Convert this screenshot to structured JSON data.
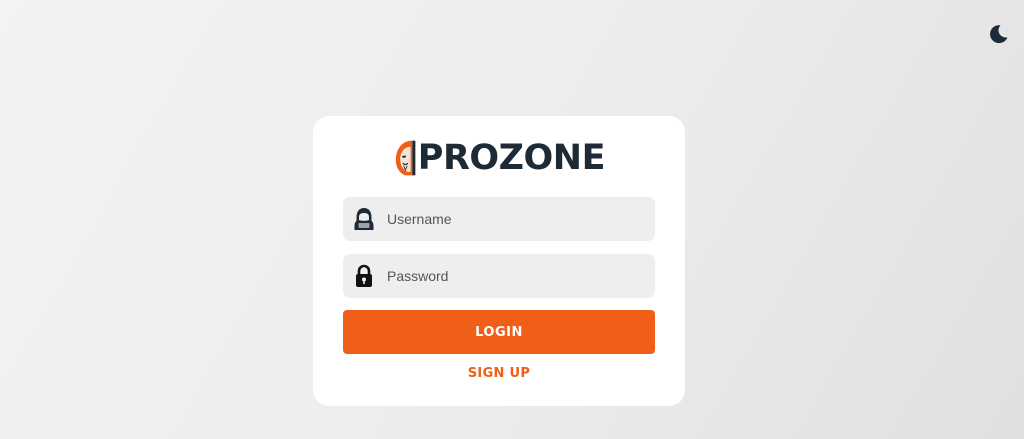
{
  "header": {
    "theme_toggle_icon": "moon-icon"
  },
  "login_card": {
    "logo_text": "PROZONE",
    "logo_icon": "anonymous-mask-icon",
    "username": {
      "icon": "hacker-hood-icon",
      "placeholder": "Username",
      "value": ""
    },
    "password": {
      "icon": "lock-icon",
      "placeholder": "Password",
      "value": ""
    },
    "login_label": "LOGIN",
    "signup_label": "SIGN UP"
  },
  "colors": {
    "accent": "#ef5f17",
    "logo_text": "#1e2a35",
    "field_bg": "#eeeeee",
    "card_bg": "#ffffff"
  }
}
